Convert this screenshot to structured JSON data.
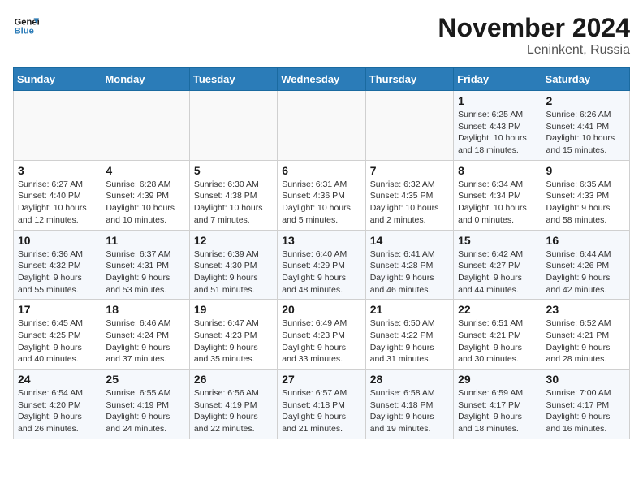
{
  "logo": {
    "line1": "General",
    "line2": "Blue"
  },
  "title": "November 2024",
  "location": "Leninkent, Russia",
  "days_of_week": [
    "Sunday",
    "Monday",
    "Tuesday",
    "Wednesday",
    "Thursday",
    "Friday",
    "Saturday"
  ],
  "weeks": [
    [
      {
        "day": "",
        "info": ""
      },
      {
        "day": "",
        "info": ""
      },
      {
        "day": "",
        "info": ""
      },
      {
        "day": "",
        "info": ""
      },
      {
        "day": "",
        "info": ""
      },
      {
        "day": "1",
        "info": "Sunrise: 6:25 AM\nSunset: 4:43 PM\nDaylight: 10 hours and 18 minutes."
      },
      {
        "day": "2",
        "info": "Sunrise: 6:26 AM\nSunset: 4:41 PM\nDaylight: 10 hours and 15 minutes."
      }
    ],
    [
      {
        "day": "3",
        "info": "Sunrise: 6:27 AM\nSunset: 4:40 PM\nDaylight: 10 hours and 12 minutes."
      },
      {
        "day": "4",
        "info": "Sunrise: 6:28 AM\nSunset: 4:39 PM\nDaylight: 10 hours and 10 minutes."
      },
      {
        "day": "5",
        "info": "Sunrise: 6:30 AM\nSunset: 4:38 PM\nDaylight: 10 hours and 7 minutes."
      },
      {
        "day": "6",
        "info": "Sunrise: 6:31 AM\nSunset: 4:36 PM\nDaylight: 10 hours and 5 minutes."
      },
      {
        "day": "7",
        "info": "Sunrise: 6:32 AM\nSunset: 4:35 PM\nDaylight: 10 hours and 2 minutes."
      },
      {
        "day": "8",
        "info": "Sunrise: 6:34 AM\nSunset: 4:34 PM\nDaylight: 10 hours and 0 minutes."
      },
      {
        "day": "9",
        "info": "Sunrise: 6:35 AM\nSunset: 4:33 PM\nDaylight: 9 hours and 58 minutes."
      }
    ],
    [
      {
        "day": "10",
        "info": "Sunrise: 6:36 AM\nSunset: 4:32 PM\nDaylight: 9 hours and 55 minutes."
      },
      {
        "day": "11",
        "info": "Sunrise: 6:37 AM\nSunset: 4:31 PM\nDaylight: 9 hours and 53 minutes."
      },
      {
        "day": "12",
        "info": "Sunrise: 6:39 AM\nSunset: 4:30 PM\nDaylight: 9 hours and 51 minutes."
      },
      {
        "day": "13",
        "info": "Sunrise: 6:40 AM\nSunset: 4:29 PM\nDaylight: 9 hours and 48 minutes."
      },
      {
        "day": "14",
        "info": "Sunrise: 6:41 AM\nSunset: 4:28 PM\nDaylight: 9 hours and 46 minutes."
      },
      {
        "day": "15",
        "info": "Sunrise: 6:42 AM\nSunset: 4:27 PM\nDaylight: 9 hours and 44 minutes."
      },
      {
        "day": "16",
        "info": "Sunrise: 6:44 AM\nSunset: 4:26 PM\nDaylight: 9 hours and 42 minutes."
      }
    ],
    [
      {
        "day": "17",
        "info": "Sunrise: 6:45 AM\nSunset: 4:25 PM\nDaylight: 9 hours and 40 minutes."
      },
      {
        "day": "18",
        "info": "Sunrise: 6:46 AM\nSunset: 4:24 PM\nDaylight: 9 hours and 37 minutes."
      },
      {
        "day": "19",
        "info": "Sunrise: 6:47 AM\nSunset: 4:23 PM\nDaylight: 9 hours and 35 minutes."
      },
      {
        "day": "20",
        "info": "Sunrise: 6:49 AM\nSunset: 4:23 PM\nDaylight: 9 hours and 33 minutes."
      },
      {
        "day": "21",
        "info": "Sunrise: 6:50 AM\nSunset: 4:22 PM\nDaylight: 9 hours and 31 minutes."
      },
      {
        "day": "22",
        "info": "Sunrise: 6:51 AM\nSunset: 4:21 PM\nDaylight: 9 hours and 30 minutes."
      },
      {
        "day": "23",
        "info": "Sunrise: 6:52 AM\nSunset: 4:21 PM\nDaylight: 9 hours and 28 minutes."
      }
    ],
    [
      {
        "day": "24",
        "info": "Sunrise: 6:54 AM\nSunset: 4:20 PM\nDaylight: 9 hours and 26 minutes."
      },
      {
        "day": "25",
        "info": "Sunrise: 6:55 AM\nSunset: 4:19 PM\nDaylight: 9 hours and 24 minutes."
      },
      {
        "day": "26",
        "info": "Sunrise: 6:56 AM\nSunset: 4:19 PM\nDaylight: 9 hours and 22 minutes."
      },
      {
        "day": "27",
        "info": "Sunrise: 6:57 AM\nSunset: 4:18 PM\nDaylight: 9 hours and 21 minutes."
      },
      {
        "day": "28",
        "info": "Sunrise: 6:58 AM\nSunset: 4:18 PM\nDaylight: 9 hours and 19 minutes."
      },
      {
        "day": "29",
        "info": "Sunrise: 6:59 AM\nSunset: 4:17 PM\nDaylight: 9 hours and 18 minutes."
      },
      {
        "day": "30",
        "info": "Sunrise: 7:00 AM\nSunset: 4:17 PM\nDaylight: 9 hours and 16 minutes."
      }
    ]
  ]
}
